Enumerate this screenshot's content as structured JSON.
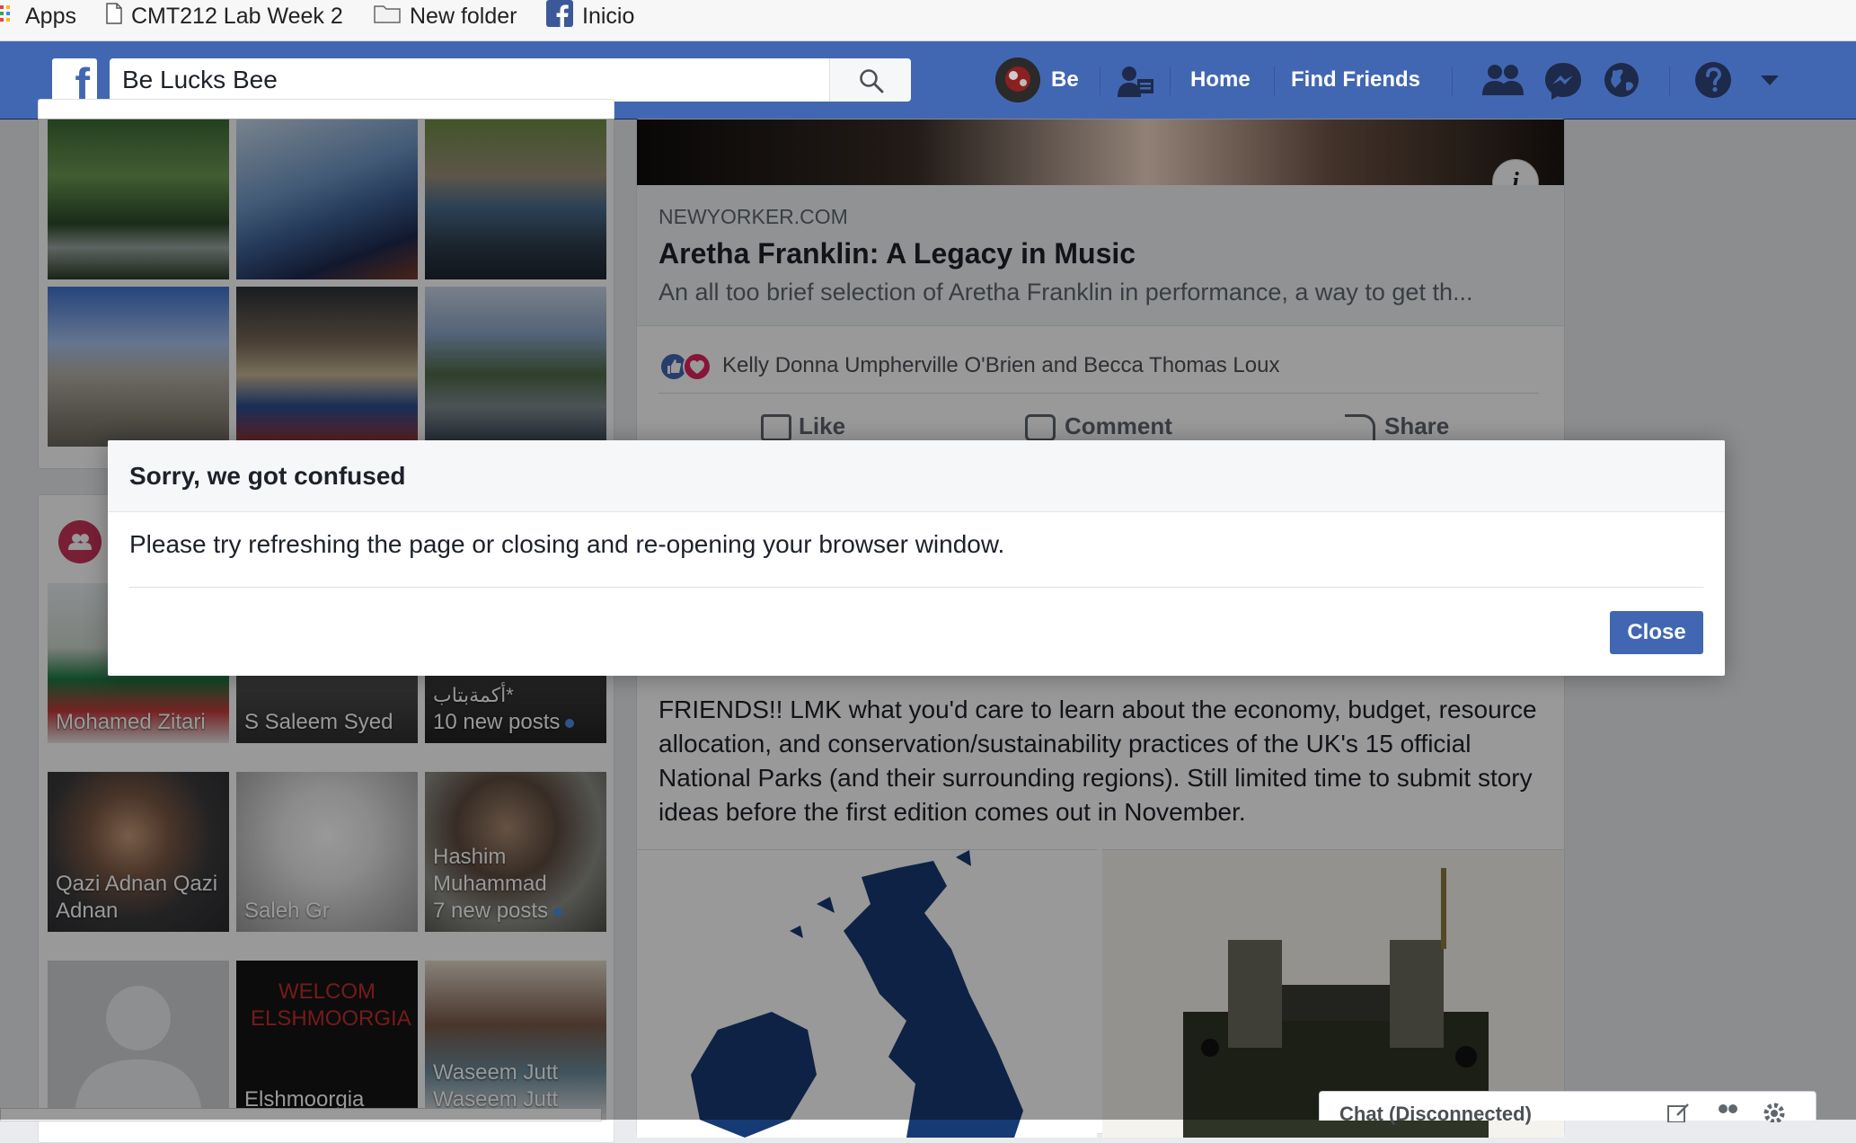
{
  "bookmarks": {
    "items": [
      {
        "label": "Apps",
        "icon": "apps-grid-icon"
      },
      {
        "label": "CMT212 Lab Week 2",
        "icon": "page-icon"
      },
      {
        "label": "New folder",
        "icon": "folder-icon"
      },
      {
        "label": "Inicio",
        "icon": "facebook-icon"
      }
    ]
  },
  "header": {
    "search_value": "Be Lucks Bee",
    "profile_name": "Be",
    "nav": {
      "home": "Home",
      "find_friends": "Find Friends"
    }
  },
  "colors": {
    "brand": "#4267b2",
    "dialog_header": "#f6f7f9",
    "notification_dot": "#4a90e2"
  },
  "post1": {
    "domain": "NEWYORKER.COM",
    "title": "Aretha Franklin: A Legacy in Music",
    "description": "An all too brief selection of Aretha Franklin in performance, a way to get th...",
    "reactions_text": "Kelly Donna Umpherville O'Brien and Becca Thomas Loux",
    "actions": {
      "like": "Like",
      "comment": "Comment",
      "share": "Share"
    }
  },
  "post2": {
    "text": "FRIENDS!! LMK what you'd care to learn about the economy, budget, resource allocation, and conservation/sustainability practices of the UK's 15 official National Parks (and their surrounding regions). Still limited time to submit story ideas before the first edition comes out in November."
  },
  "friends": {
    "tiles": [
      {
        "name": "Mohamed Zitari"
      },
      {
        "name": "S Saleem Syed"
      },
      {
        "name": "أكمةبتاب*",
        "extra": "10 new posts"
      },
      {
        "name": "Qazi Adnan Qazi Adnan"
      },
      {
        "name": "Saleh Gr"
      },
      {
        "name": "Hashim Muhammad",
        "extra": "7 new posts"
      },
      {
        "name": ""
      },
      {
        "name": "Elshmoorgia",
        "banner": "WELCOM ELSHMOORGIA"
      },
      {
        "name": "Waseem Jutt Waseem Jutt"
      }
    ]
  },
  "dialog": {
    "title": "Sorry, we got confused",
    "message": "Please try refreshing the page or closing and re-opening your browser window.",
    "close_label": "Close"
  },
  "chat": {
    "label": "Chat (Disconnected)"
  }
}
